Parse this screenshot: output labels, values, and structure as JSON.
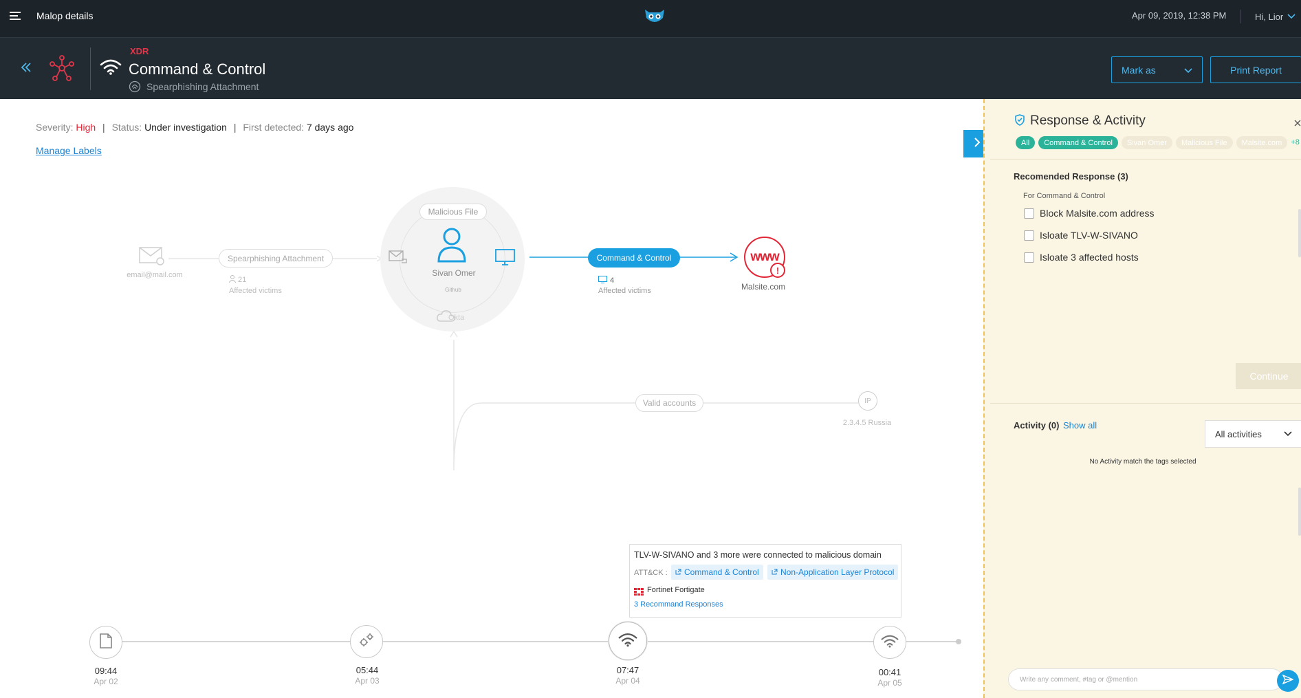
{
  "topbar": {
    "title": "Malop details",
    "datetime": "Apr 09, 2019, 12:38 PM",
    "greeting": "Hi, Lior"
  },
  "header": {
    "category": "XDR",
    "title": "Command & Control",
    "subtitle": "Spearphishing Attachment",
    "mark_as": "Mark as",
    "print_report": "Print Report"
  },
  "meta": {
    "severity_label": "Severity:",
    "severity_value": "High",
    "status_label": "Status:",
    "status_value": "Under investigation",
    "first_detected_label": "First detected:",
    "first_detected_value": "7 days ago",
    "separator": "|",
    "manage_labels": "Manage Labels"
  },
  "graph": {
    "email": "email@mail.com",
    "spearphishing": "Spearphishing Attachment",
    "spear_victims_count": "21",
    "spear_victims_label": "Affected victims",
    "malicious_file": "Malicious File",
    "user_name": "Sivan Omer",
    "group_label": "Github",
    "cloud_label": "Okta",
    "cc_pill": "Command & Control",
    "cc_victims_count": "4",
    "cc_victims_label": "Affected victims",
    "www": "www",
    "malsite": "Malsite.com",
    "valid_accounts": "Valid accounts",
    "ip_badge": "IP",
    "ip_label": "2.3.4.5 Russia"
  },
  "event_card": {
    "title": "TLV-W-SIVANO and 3 more were connected to malicious domain",
    "attck_label": "ATT&CK :",
    "chip1": "Command & Control",
    "chip2": "Non-Application Layer Protocol",
    "vendor": "Fortinet Fortigate",
    "responses": "3 Recommand Responses"
  },
  "timeline": [
    {
      "time": "09:44",
      "date": "Apr 02"
    },
    {
      "time": "05:44",
      "date": "Apr 03"
    },
    {
      "time": "07:47",
      "date": "Apr 04"
    },
    {
      "time": "00:41",
      "date": "Apr 05"
    }
  ],
  "panel": {
    "title": "Response & Activity",
    "tags": [
      "All",
      "Command & Control",
      "Sivan Omer",
      "Malicious File",
      "Malsite.com"
    ],
    "more_tags": "+8",
    "recommended_title": "Recomended Response (3)",
    "for_label": "For Command & Control",
    "actions": [
      "Block Malsite.com address",
      "Isloate TLV-W-SIVANO",
      "Isloate 3 affected hosts"
    ],
    "continue": "Continue",
    "activity_title": "Activity (0)",
    "show_all": "Show all",
    "all_activities": "All activities",
    "no_activity": "No Activity match the tags selected",
    "comment_placeholder": "Write any comment, #tag or @mention"
  },
  "colors": {
    "accent": "#1a9fe0",
    "danger": "#e32636",
    "teal": "#2bb39a",
    "panel_bg": "#fbf6e4"
  }
}
